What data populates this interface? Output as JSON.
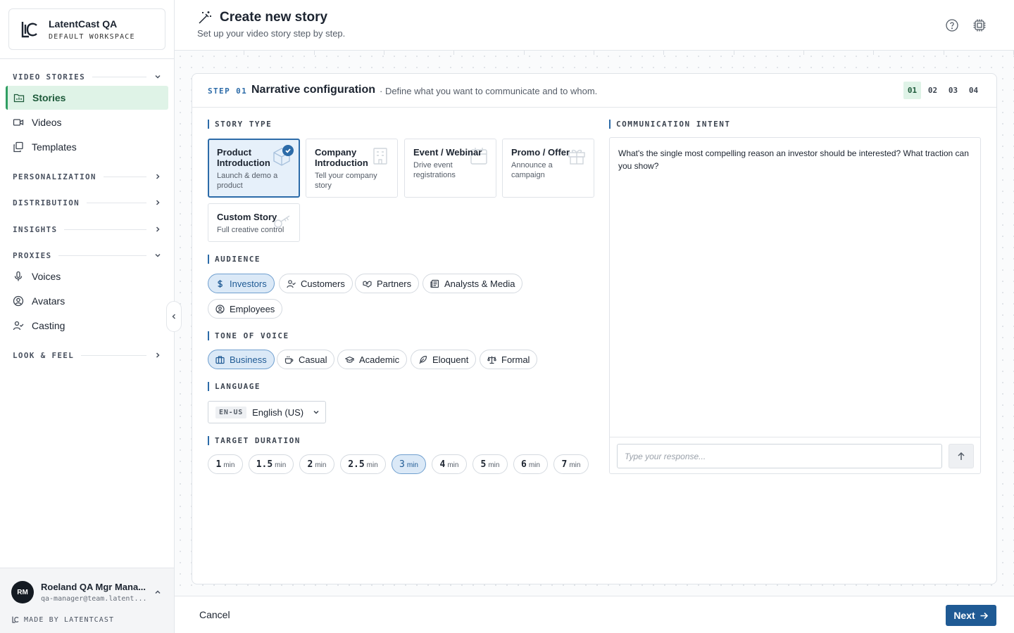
{
  "workspace": {
    "name": "LatentCast QA",
    "subtitle": "DEFAULT WORKSPACE"
  },
  "sidebar": {
    "sections": {
      "video_stories": "VIDEO STORIES",
      "personalization": "PERSONALIZATION",
      "distribution": "DISTRIBUTION",
      "insights": "INSIGHTS",
      "proxies": "PROXIES",
      "look_feel": "LOOK & FEEL"
    },
    "items": {
      "stories": "Stories",
      "videos": "Videos",
      "templates": "Templates",
      "voices": "Voices",
      "avatars": "Avatars",
      "casting": "Casting"
    },
    "user": {
      "initials": "RM",
      "name": "Roeland QA Mgr Mana...",
      "email": "qa-manager@team.latent..."
    },
    "made_by": "MADE BY LATENTCAST"
  },
  "header": {
    "title": "Create new story",
    "subtitle": "Set up your video story step by step."
  },
  "card": {
    "step_tag": "STEP 01",
    "title": "Narrative configuration",
    "description": "· Define what you want to communicate and to whom.",
    "steps": [
      "01",
      "02",
      "03",
      "04"
    ],
    "active_step": "01"
  },
  "story_type": {
    "label": "STORY TYPE",
    "options": [
      {
        "title": "Product Introduction",
        "desc": "Launch & demo a product",
        "selected": true,
        "icon": "box-icon"
      },
      {
        "title": "Company Introduction",
        "desc": "Tell your company story",
        "selected": false,
        "icon": "building-icon"
      },
      {
        "title": "Event / Webinar",
        "desc": "Drive event registrations",
        "selected": false,
        "icon": "calendar-icon"
      },
      {
        "title": "Promo / Offer",
        "desc": "Announce a campaign",
        "selected": false,
        "icon": "gift-icon"
      },
      {
        "title": "Custom Story",
        "desc": "Full creative control",
        "selected": false,
        "icon": "key-icon"
      }
    ]
  },
  "audience": {
    "label": "AUDIENCE",
    "options": [
      "Investors",
      "Customers",
      "Partners",
      "Analysts & Media",
      "Employees"
    ],
    "selected": "Investors"
  },
  "tone": {
    "label": "TONE OF VOICE",
    "options": [
      "Business",
      "Casual",
      "Academic",
      "Eloquent",
      "Formal"
    ],
    "selected": "Business"
  },
  "language": {
    "label": "LANGUAGE",
    "code": "EN-US",
    "name": "English (US)"
  },
  "duration": {
    "label": "TARGET DURATION",
    "unit": "min",
    "options": [
      "1",
      "1.5",
      "2",
      "2.5",
      "3",
      "4",
      "5",
      "6",
      "7"
    ],
    "selected": "3"
  },
  "intent": {
    "label": "COMMUNICATION INTENT",
    "text": "What's the single most compelling reason an investor should be interested? What traction can you show?",
    "placeholder": "Type your response..."
  },
  "footer": {
    "cancel": "Cancel",
    "next": "Next"
  },
  "colors": {
    "accent": "#1f5a94",
    "active_nav": "#dff3e7",
    "selected_fill": "#dbe9f7"
  }
}
